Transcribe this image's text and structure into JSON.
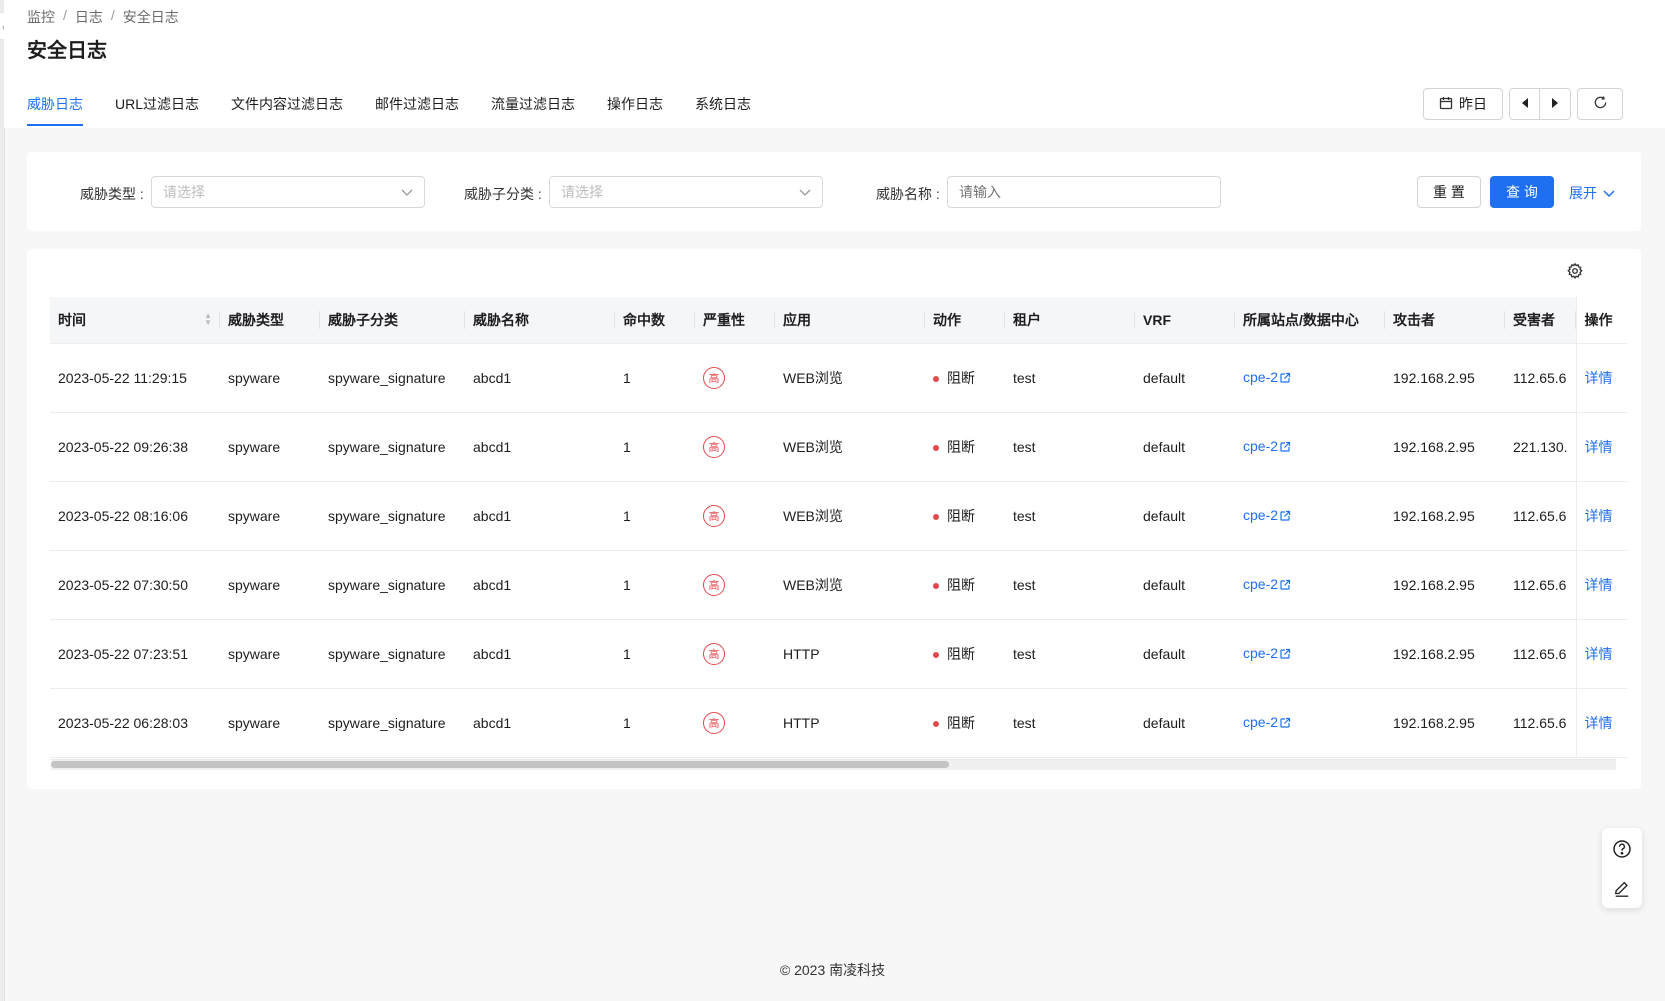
{
  "breadcrumb": [
    "监控",
    "日志",
    "安全日志"
  ],
  "page_title": "安全日志",
  "tabs": [
    {
      "label": "威胁日志",
      "active": true
    },
    {
      "label": "URL过滤日志",
      "active": false
    },
    {
      "label": "文件内容过滤日志",
      "active": false
    },
    {
      "label": "邮件过滤日志",
      "active": false
    },
    {
      "label": "流量过滤日志",
      "active": false
    },
    {
      "label": "操作日志",
      "active": false
    },
    {
      "label": "系统日志",
      "active": false
    }
  ],
  "date_controls": {
    "date_label": "昨日",
    "calendar_icon": "calendar-icon",
    "prev_icon": "caret-left-icon",
    "next_icon": "caret-right-icon",
    "refresh_icon": "refresh-icon"
  },
  "filters": {
    "threat_type": {
      "label": "威胁类型 :",
      "placeholder": "请选择"
    },
    "threat_subtype": {
      "label": "威胁子分类 :",
      "placeholder": "请选择"
    },
    "threat_name": {
      "label": "威胁名称 :",
      "placeholder": "请输入"
    },
    "reset_label": "重 置",
    "query_label": "查 询",
    "expand_label": "展开"
  },
  "table": {
    "columns": [
      "时间",
      "威胁类型",
      "威胁子分类",
      "威胁名称",
      "命中数",
      "严重性",
      "应用",
      "动作",
      "租户",
      "VRF",
      "所属站点/数据中心",
      "攻击者",
      "受害者",
      "操作"
    ],
    "rows": [
      {
        "time": "2023-05-22 11:29:15",
        "type": "spyware",
        "subtype": "spyware_signature",
        "name": "abcd1",
        "hits": "1",
        "severity": "高",
        "app": "WEB浏览",
        "action": "阻断",
        "tenant": "test",
        "vrf": "default",
        "site": "cpe-2",
        "attacker": "192.168.2.95",
        "victim": "112.65.6",
        "op": "详情"
      },
      {
        "time": "2023-05-22 09:26:38",
        "type": "spyware",
        "subtype": "spyware_signature",
        "name": "abcd1",
        "hits": "1",
        "severity": "高",
        "app": "WEB浏览",
        "action": "阻断",
        "tenant": "test",
        "vrf": "default",
        "site": "cpe-2",
        "attacker": "192.168.2.95",
        "victim": "221.130.",
        "op": "详情"
      },
      {
        "time": "2023-05-22 08:16:06",
        "type": "spyware",
        "subtype": "spyware_signature",
        "name": "abcd1",
        "hits": "1",
        "severity": "高",
        "app": "WEB浏览",
        "action": "阻断",
        "tenant": "test",
        "vrf": "default",
        "site": "cpe-2",
        "attacker": "192.168.2.95",
        "victim": "112.65.6",
        "op": "详情"
      },
      {
        "time": "2023-05-22 07:30:50",
        "type": "spyware",
        "subtype": "spyware_signature",
        "name": "abcd1",
        "hits": "1",
        "severity": "高",
        "app": "WEB浏览",
        "action": "阻断",
        "tenant": "test",
        "vrf": "default",
        "site": "cpe-2",
        "attacker": "192.168.2.95",
        "victim": "112.65.6",
        "op": "详情"
      },
      {
        "time": "2023-05-22 07:23:51",
        "type": "spyware",
        "subtype": "spyware_signature",
        "name": "abcd1",
        "hits": "1",
        "severity": "高",
        "app": "HTTP",
        "action": "阻断",
        "tenant": "test",
        "vrf": "default",
        "site": "cpe-2",
        "attacker": "192.168.2.95",
        "victim": "112.65.6",
        "op": "详情"
      },
      {
        "time": "2023-05-22 06:28:03",
        "type": "spyware",
        "subtype": "spyware_signature",
        "name": "abcd1",
        "hits": "1",
        "severity": "高",
        "app": "HTTP",
        "action": "阻断",
        "tenant": "test",
        "vrf": "default",
        "site": "cpe-2",
        "attacker": "192.168.2.95",
        "victim": "112.65.6",
        "op": "详情"
      }
    ]
  },
  "colors": {
    "accent": "#1e6ff2",
    "danger": "#e5484d"
  },
  "footer": "© 2023 南凌科技"
}
